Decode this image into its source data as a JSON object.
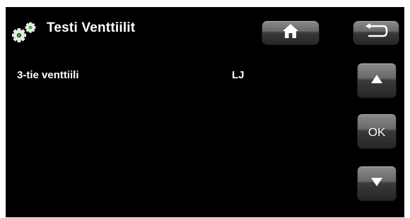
{
  "header": {
    "title": "Testi Venttiilit",
    "icon": "settings-gears-icon",
    "home_icon": "home-icon",
    "back_icon": "back-arrow-icon"
  },
  "rows": [
    {
      "label": "3-tie venttiili",
      "value": "LJ"
    }
  ],
  "nav": {
    "up_icon": "up-arrow-icon",
    "ok_label": "OK",
    "down_icon": "down-arrow-icon"
  },
  "colors": {
    "background": "#000000",
    "text": "#ffffff",
    "button": "#555555",
    "gear_primary": "#e8e8e8",
    "gear_accent": "#3bbf3b"
  }
}
